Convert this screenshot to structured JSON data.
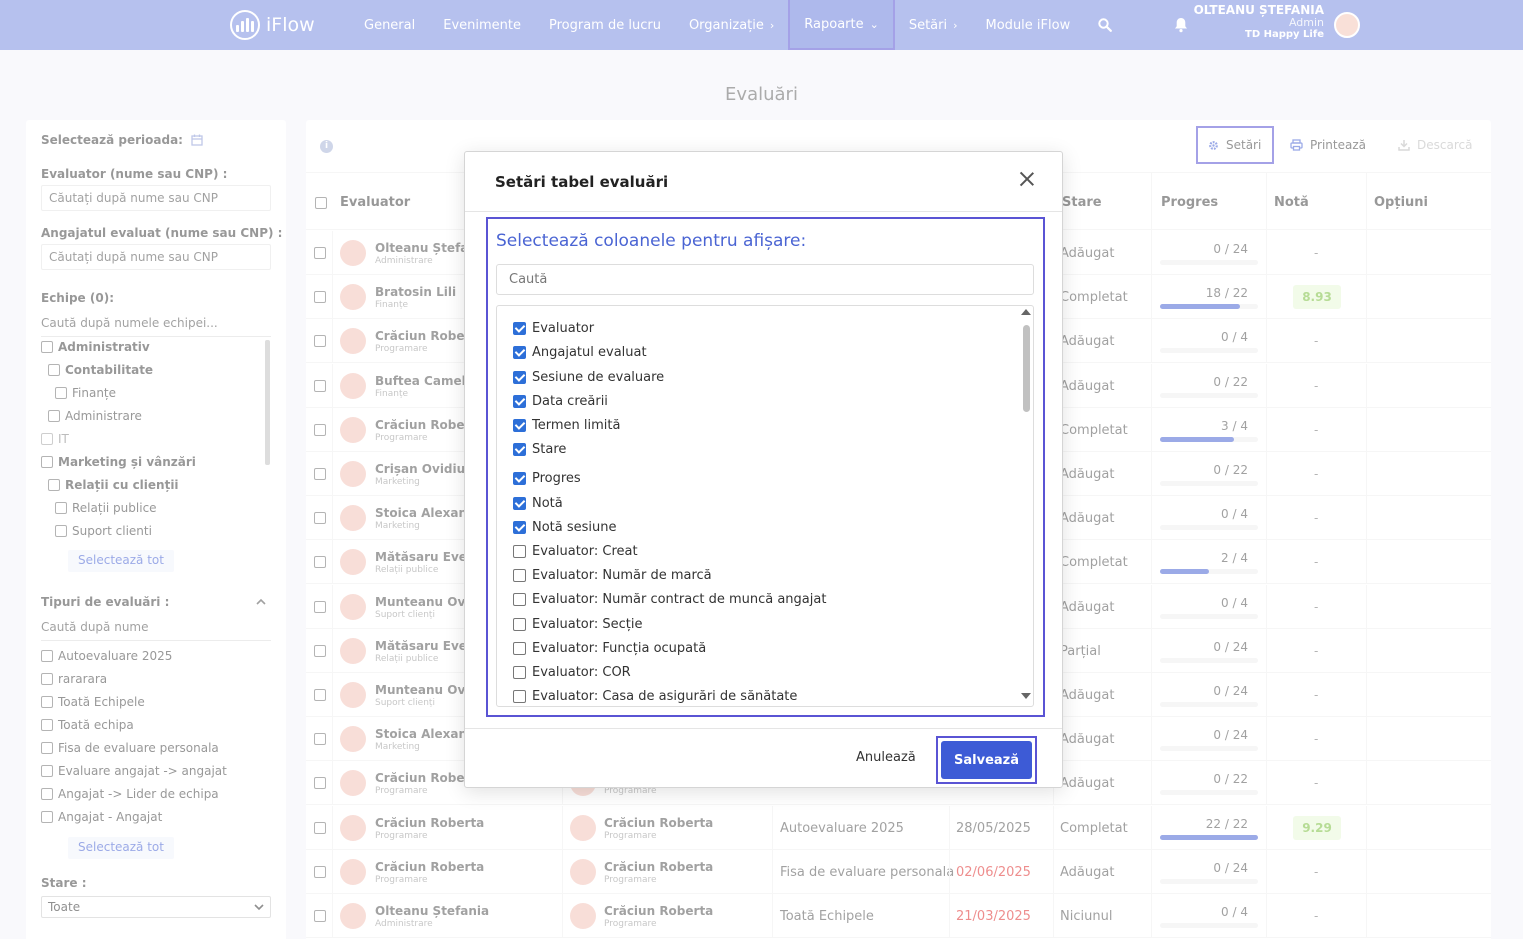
{
  "app": {
    "logo": "iFlow"
  },
  "nav": [
    {
      "label": "General"
    },
    {
      "label": "Evenimente"
    },
    {
      "label": "Program de lucru"
    },
    {
      "label": "Organizație",
      "chevron": "›"
    },
    {
      "label": "Rapoarte",
      "chevron": "⌄"
    },
    {
      "label": "Setări",
      "chevron": "›"
    },
    {
      "label": "Module iFlow"
    }
  ],
  "user": {
    "name": "OLTEANU ȘTEFANIA",
    "role": "Admin",
    "org": "TD Happy Life"
  },
  "page_title": "Evaluări",
  "filters": {
    "period_label": "Selectează perioada:",
    "evaluator_label": "Evaluator (nume sau CNP) :",
    "evaluator_placeholder": "Căutați după nume sau CNP",
    "evaluated_label": "Angajatul evaluat (nume sau CNP) :",
    "evaluated_placeholder": "Căutați după nume sau CNP",
    "teams_label": "Echipe (0):",
    "teams_placeholder": "Caută după numele echipei...",
    "teams": [
      {
        "label": "Administrativ",
        "bold": true,
        "indent": 0
      },
      {
        "label": "Contabilitate",
        "bold": true,
        "indent": 1
      },
      {
        "label": "Finanțe",
        "bold": false,
        "indent": 2
      },
      {
        "label": "Administrare",
        "bold": false,
        "indent": 1
      },
      {
        "label": "IT",
        "bold": false,
        "indent": 0
      },
      {
        "label": "Marketing și vânzări",
        "bold": true,
        "indent": 0
      },
      {
        "label": "Relații cu clienții",
        "bold": true,
        "indent": 1
      },
      {
        "label": "Relații publice",
        "bold": false,
        "indent": 2
      },
      {
        "label": "Suport clienti",
        "bold": false,
        "indent": 2
      }
    ],
    "select_all": "Selectează tot",
    "types_label": "Tipuri de evaluări :",
    "types_placeholder": "Caută după nume",
    "types": [
      "Autoevaluare 2025",
      "rararara",
      "Toată Echipele",
      "Toată echipa",
      "Fisa de evaluare personala",
      "Evaluare angajat -> angajat",
      "Angajat -> Lider de echipa",
      "Angajat - Angajat"
    ],
    "state_label": "Stare :",
    "state_value": "Toate"
  },
  "toolbar": {
    "settings": "Setări",
    "print": "Printează",
    "download": "Descarcă"
  },
  "table": {
    "headers": {
      "evaluator": "Evaluator",
      "state": "Stare",
      "progress": "Progres",
      "grade": "Notă",
      "options": "Opțiuni"
    },
    "rows": [
      {
        "name": "Olteanu Ștefan",
        "dept": "Administrare",
        "state": "Adăugat",
        "progress": "0 / 24",
        "pct": 0,
        "grade": "-"
      },
      {
        "name": "Bratosin Lili",
        "dept": "Finanțe",
        "state": "Completat",
        "progress": "18 / 22",
        "pct": 82,
        "grade": "8.93"
      },
      {
        "name": "Crăciun Robert",
        "dept": "Programare",
        "state": "Adăugat",
        "progress": "0 / 4",
        "pct": 0,
        "grade": "-"
      },
      {
        "name": "Buftea Camelia",
        "dept": "Finanțe",
        "state": "Adăugat",
        "progress": "0 / 22",
        "pct": 0,
        "grade": "-"
      },
      {
        "name": "Crăciun Robert",
        "dept": "Programare",
        "state": "Completat",
        "progress": "3 / 4",
        "pct": 75,
        "grade": "-"
      },
      {
        "name": "Crișan Ovidiu",
        "dept": "Marketing",
        "state": "Adăugat",
        "progress": "0 / 22",
        "pct": 0,
        "grade": "-"
      },
      {
        "name": "Stoica Alexand",
        "dept": "Marketing",
        "state": "Adăugat",
        "progress": "0 / 4",
        "pct": 0,
        "grade": "-"
      },
      {
        "name": "Mătăsaru Eveli",
        "dept": "Relații publice",
        "state": "Completat",
        "progress": "2 / 4",
        "pct": 50,
        "grade": "-"
      },
      {
        "name": "Munteanu Ovic",
        "dept": "Suport clienți",
        "state": "Adăugat",
        "progress": "0 / 4",
        "pct": 0,
        "grade": "-"
      },
      {
        "name": "Mătăsaru Eveli",
        "dept": "Relații publice",
        "state": "Parțial",
        "progress": "0 / 24",
        "pct": 0,
        "grade": "-"
      },
      {
        "name": "Munteanu Ovic",
        "dept": "Suport clienți",
        "state": "Adăugat",
        "progress": "0 / 24",
        "pct": 0,
        "grade": "-"
      },
      {
        "name": "Stoica Alexand",
        "dept": "Marketing",
        "state": "Adăugat",
        "progress": "0 / 24",
        "pct": 0,
        "grade": "-"
      },
      {
        "name": "Crăciun Robert",
        "dept": "Programare",
        "name2": "",
        "dept2": "Programare",
        "state": "Adăugat",
        "progress": "0 / 22",
        "pct": 0,
        "grade": "-"
      },
      {
        "name": "Crăciun Roberta",
        "dept": "Programare",
        "name2": "Crăciun Roberta",
        "dept2": "Programare",
        "session": "Autoevaluare 2025",
        "date": "28/05/2025",
        "date_red": false,
        "state": "Completat",
        "progress": "22 / 22",
        "pct": 100,
        "grade": "9.29"
      },
      {
        "name": "Crăciun Roberta",
        "dept": "Programare",
        "name2": "Crăciun Roberta",
        "dept2": "Programare",
        "session": "Fisa de evaluare personala",
        "date": "02/06/2025",
        "date_red": true,
        "state": "Adăugat",
        "progress": "0 / 24",
        "pct": 0,
        "grade": "-"
      },
      {
        "name": "Olteanu Ștefania",
        "dept": "Administrare",
        "name2": "Crăciun Roberta",
        "dept2": "Programare",
        "session": "Toată Echipele",
        "date": "21/03/2025",
        "date_red": true,
        "state": "Niciunul",
        "progress": "0 / 4",
        "pct": 0,
        "grade": "-"
      }
    ]
  },
  "modal": {
    "title": "Setări tabel evaluări",
    "subtitle": "Selectează coloanele pentru afișare:",
    "search_placeholder": "Caută",
    "options": [
      {
        "label": "Evaluator",
        "checked": true
      },
      {
        "label": "Angajatul evaluat",
        "checked": true
      },
      {
        "label": "Sesiune de evaluare",
        "checked": true
      },
      {
        "label": "Data creării",
        "checked": true
      },
      {
        "label": "Termen limită",
        "checked": true
      },
      {
        "label": "Stare",
        "checked": true
      },
      {
        "label": "Progres",
        "checked": true
      },
      {
        "label": "Notă",
        "checked": true
      },
      {
        "label": "Notă sesiune",
        "checked": true
      },
      {
        "label": "Evaluator: Creat",
        "checked": false
      },
      {
        "label": "Evaluator: Număr de marcă",
        "checked": false
      },
      {
        "label": "Evaluator: Număr contract de muncă angajat",
        "checked": false
      },
      {
        "label": "Evaluator: Secție",
        "checked": false
      },
      {
        "label": "Evaluator: Funcția ocupată",
        "checked": false
      },
      {
        "label": "Evaluator: COR",
        "checked": false
      },
      {
        "label": "Evaluator: Casa de asigurări de sănătate",
        "checked": false
      }
    ],
    "cancel": "Anulează",
    "save": "Salvează"
  },
  "colors": {
    "topbar": "#7b8ee0",
    "accent": "#4a64d3",
    "highlight": "#5a54d4",
    "grade_bg": "#e8f7d8",
    "grade_fg": "#7bbf3e",
    "danger": "#e03131"
  }
}
